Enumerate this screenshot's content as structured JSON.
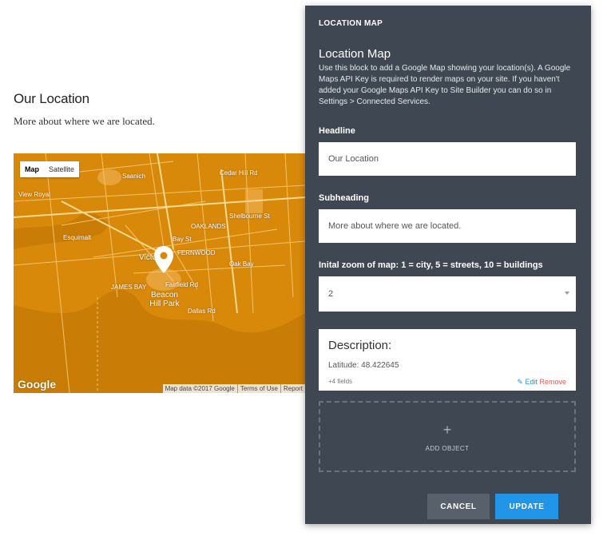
{
  "page": {
    "title": "Our Location",
    "subtitle": "More about where we are located."
  },
  "map": {
    "toggle": [
      "Map",
      "Satellite"
    ],
    "labels": {
      "saanich": "Saanich",
      "view_royal": "View Royal",
      "esquimalt": "Esquimalt",
      "victoria": "Victoria",
      "oaklands": "OAKLANDS",
      "fernwood": "FERNWOOD",
      "james_bay": "JAMES BAY",
      "beacon_hill": "Beacon Hill Park",
      "oak_bay": "Oak Bay",
      "cedar_hill": "Cedar Hill Rd",
      "shelbourne": "Shelbourne St",
      "bay_st": "Bay St",
      "fairfield": "Fairfield Rd",
      "dallas": "Dallas Rd"
    },
    "logo": "Google",
    "footer": [
      "Map data ©2017 Google",
      "Terms of Use",
      "Report"
    ],
    "color": "#d9890a"
  },
  "panel": {
    "header": "LOCATION MAP",
    "block_title": "Location Map",
    "description": "Use this block to add a Google Map showing your location(s). A Google Maps API Key is required to render maps on your site. If you haven't added your Google Maps API Key to Site Builder you can do so in Settings > Connected Services.",
    "headline_label": "Headline",
    "headline_value": "Our Location",
    "subheading_label": "Subheading",
    "subheading_value": "More about where we are located.",
    "zoom_label": "Inital zoom of map: 1 = city, 5 = streets, 10 = buildings",
    "zoom_value": "2",
    "card": {
      "title": "Description:",
      "line": "Latitude: 48.422645",
      "fields": "+4 fields",
      "edit": "Edit",
      "remove": "Remove"
    },
    "add_plus": "+",
    "add_label": "ADD OBJECT",
    "cancel": "CANCEL",
    "update": "UPDATE"
  }
}
